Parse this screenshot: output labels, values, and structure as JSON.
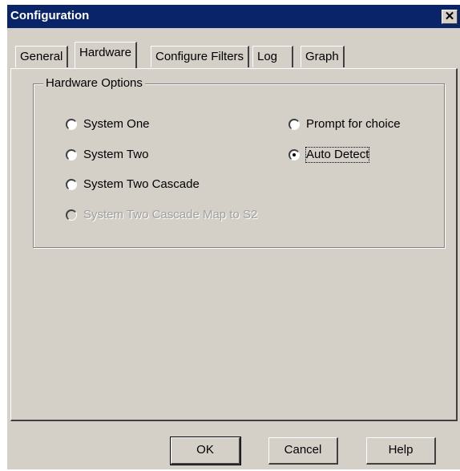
{
  "window": {
    "title": "Configuration",
    "close_glyph": "✕"
  },
  "tabs": [
    {
      "label": "General"
    },
    {
      "label": "Hardware"
    },
    {
      "label": "Configure Filters"
    },
    {
      "label": "Log"
    },
    {
      "label": "Graph"
    }
  ],
  "active_tab": "Hardware",
  "hardware_options": {
    "title": "Hardware Options",
    "options": [
      {
        "label": "System One",
        "selected": false,
        "enabled": true
      },
      {
        "label": "System Two",
        "selected": false,
        "enabled": true
      },
      {
        "label": "System Two Cascade",
        "selected": false,
        "enabled": true
      },
      {
        "label": "System Two Cascade  Map to S2",
        "selected": false,
        "enabled": false
      },
      {
        "label": "Prompt for choice",
        "selected": false,
        "enabled": true
      },
      {
        "label": "Auto Detect",
        "selected": true,
        "enabled": true
      }
    ]
  },
  "buttons": {
    "ok": "OK",
    "cancel": "Cancel",
    "help": "Help"
  },
  "colors": {
    "titlebar": "#0a246a",
    "dialog_face": "#d4d0c8"
  }
}
